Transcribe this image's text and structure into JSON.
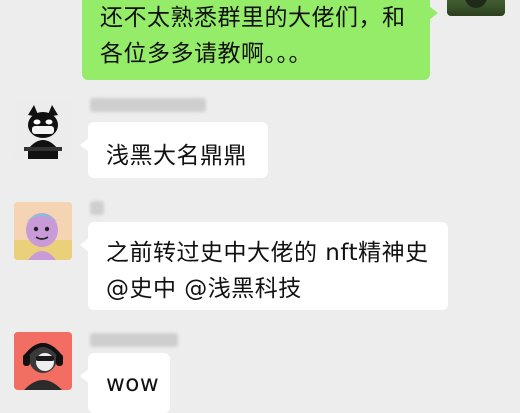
{
  "outgoing_message": {
    "line1": "还不太熟悉群里的大佬们，和",
    "line2": "各位多多请教啊。。。"
  },
  "messages": [
    {
      "avatar_icon": "masked-cat-avatar",
      "text": "浅黑大名鼎鼎"
    },
    {
      "avatar_icon": "cartoon-character-avatar",
      "line1": "之前转过史中大佬的 nft精神史",
      "line2": "@史中 @浅黑科技"
    },
    {
      "avatar_icon": "headphones-character-avatar",
      "text": "wow"
    }
  ]
}
